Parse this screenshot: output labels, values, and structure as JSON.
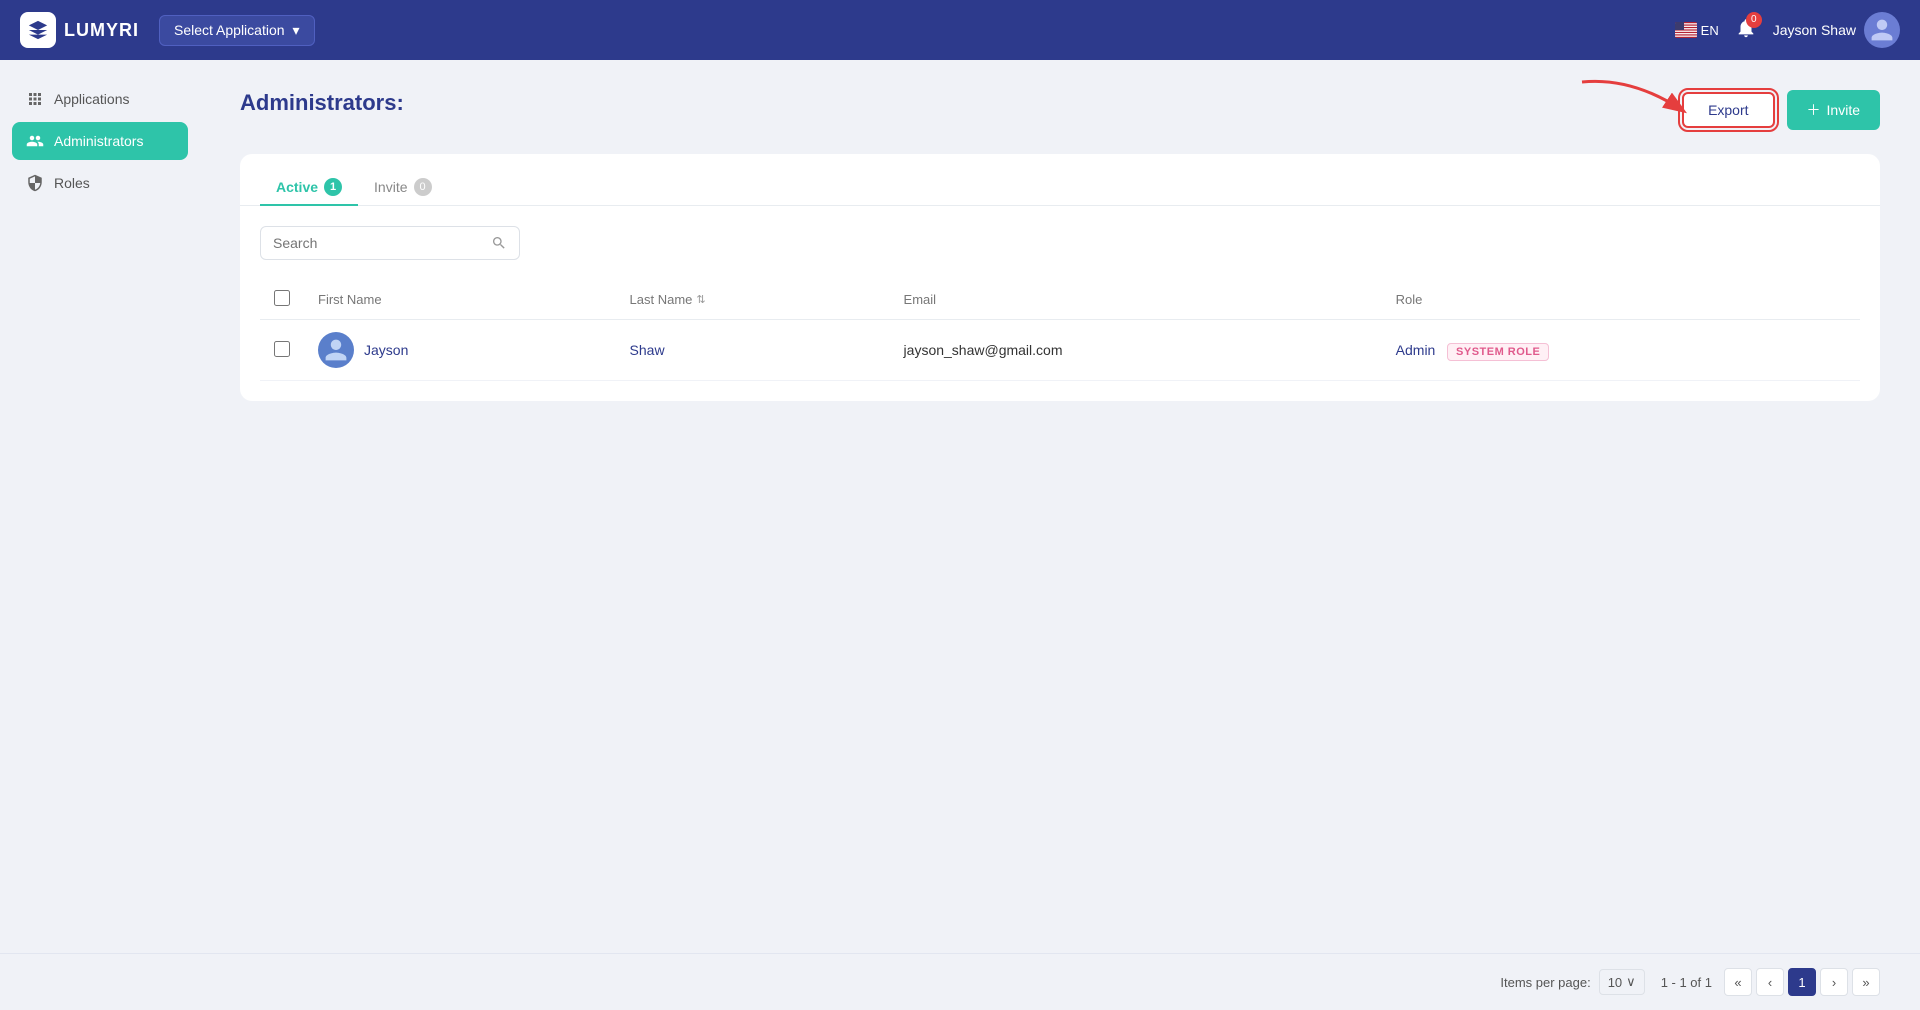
{
  "header": {
    "logo_text": "LUMYRI",
    "select_app_label": "Select Application",
    "lang": "EN",
    "notifications_count": "0",
    "user_name": "Jayson Shaw"
  },
  "sidebar": {
    "items": [
      {
        "id": "applications",
        "label": "Applications",
        "active": false
      },
      {
        "id": "administrators",
        "label": "Administrators",
        "active": true
      },
      {
        "id": "roles",
        "label": "Roles",
        "active": false
      }
    ]
  },
  "main": {
    "page_title": "Administrators:",
    "export_label": "Export",
    "invite_label": "Invite",
    "tabs": [
      {
        "id": "active",
        "label": "Active",
        "badge": "1",
        "active": true
      },
      {
        "id": "invite",
        "label": "Invite",
        "badge": "0",
        "active": false
      }
    ],
    "search_placeholder": "Search",
    "table": {
      "columns": [
        {
          "id": "first_name",
          "label": "First Name",
          "sortable": false
        },
        {
          "id": "last_name",
          "label": "Last Name",
          "sortable": true
        },
        {
          "id": "email",
          "label": "Email",
          "sortable": false
        },
        {
          "id": "role",
          "label": "Role",
          "sortable": false
        }
      ],
      "rows": [
        {
          "first_name": "Jayson",
          "last_name": "Shaw",
          "email": "jayson_shaw@gmail.com",
          "role": "Admin",
          "system_role_label": "SYSTEM ROLE"
        }
      ]
    }
  },
  "footer": {
    "items_per_page_label": "Items per page:",
    "per_page_value": "10",
    "page_info": "1 - 1 of 1",
    "current_page": "1"
  }
}
